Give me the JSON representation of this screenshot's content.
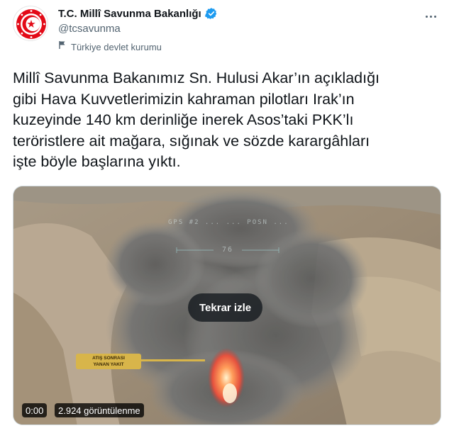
{
  "account": {
    "display_name": "T.C. Millî Savunma Bakanlığı",
    "handle": "@tcsavunma",
    "label": "Türkiye devlet kurumu",
    "avatar_icon": "ministry-seal-icon",
    "verified_icon": "verified-badge-icon",
    "label_icon": "flag-icon",
    "more_icon": "more-options-icon"
  },
  "tweet": {
    "text": "Millî Savunma Bakanımız Sn. Hulusi Akar’ın açıkladığı\ngibi Hava Kuvvetlerimizin kahraman pilotları Irak’ın\nkuzeyinde 140 km derinliğe inerek Asos’taki PKK’lı\nteröristlere ait mağara, sığınak ve sözde karargâhları\nişte böyle başlarına yıktı."
  },
  "video": {
    "replay_label": "Tekrar izle",
    "timestamp": "0:00",
    "views": "2.924 görüntülenme",
    "hud_top": "GPS #2 ... ... POSN ...",
    "hud_mid": "76",
    "annotation_tag": "ATIŞ SONRASI\nYANAN YAKIT"
  },
  "colors": {
    "verified_blue": "#1d9bf0",
    "seal_red": "#e30a17",
    "tag_gold": "#d8b54a",
    "text_primary": "#0f1419",
    "text_secondary": "#536471"
  }
}
